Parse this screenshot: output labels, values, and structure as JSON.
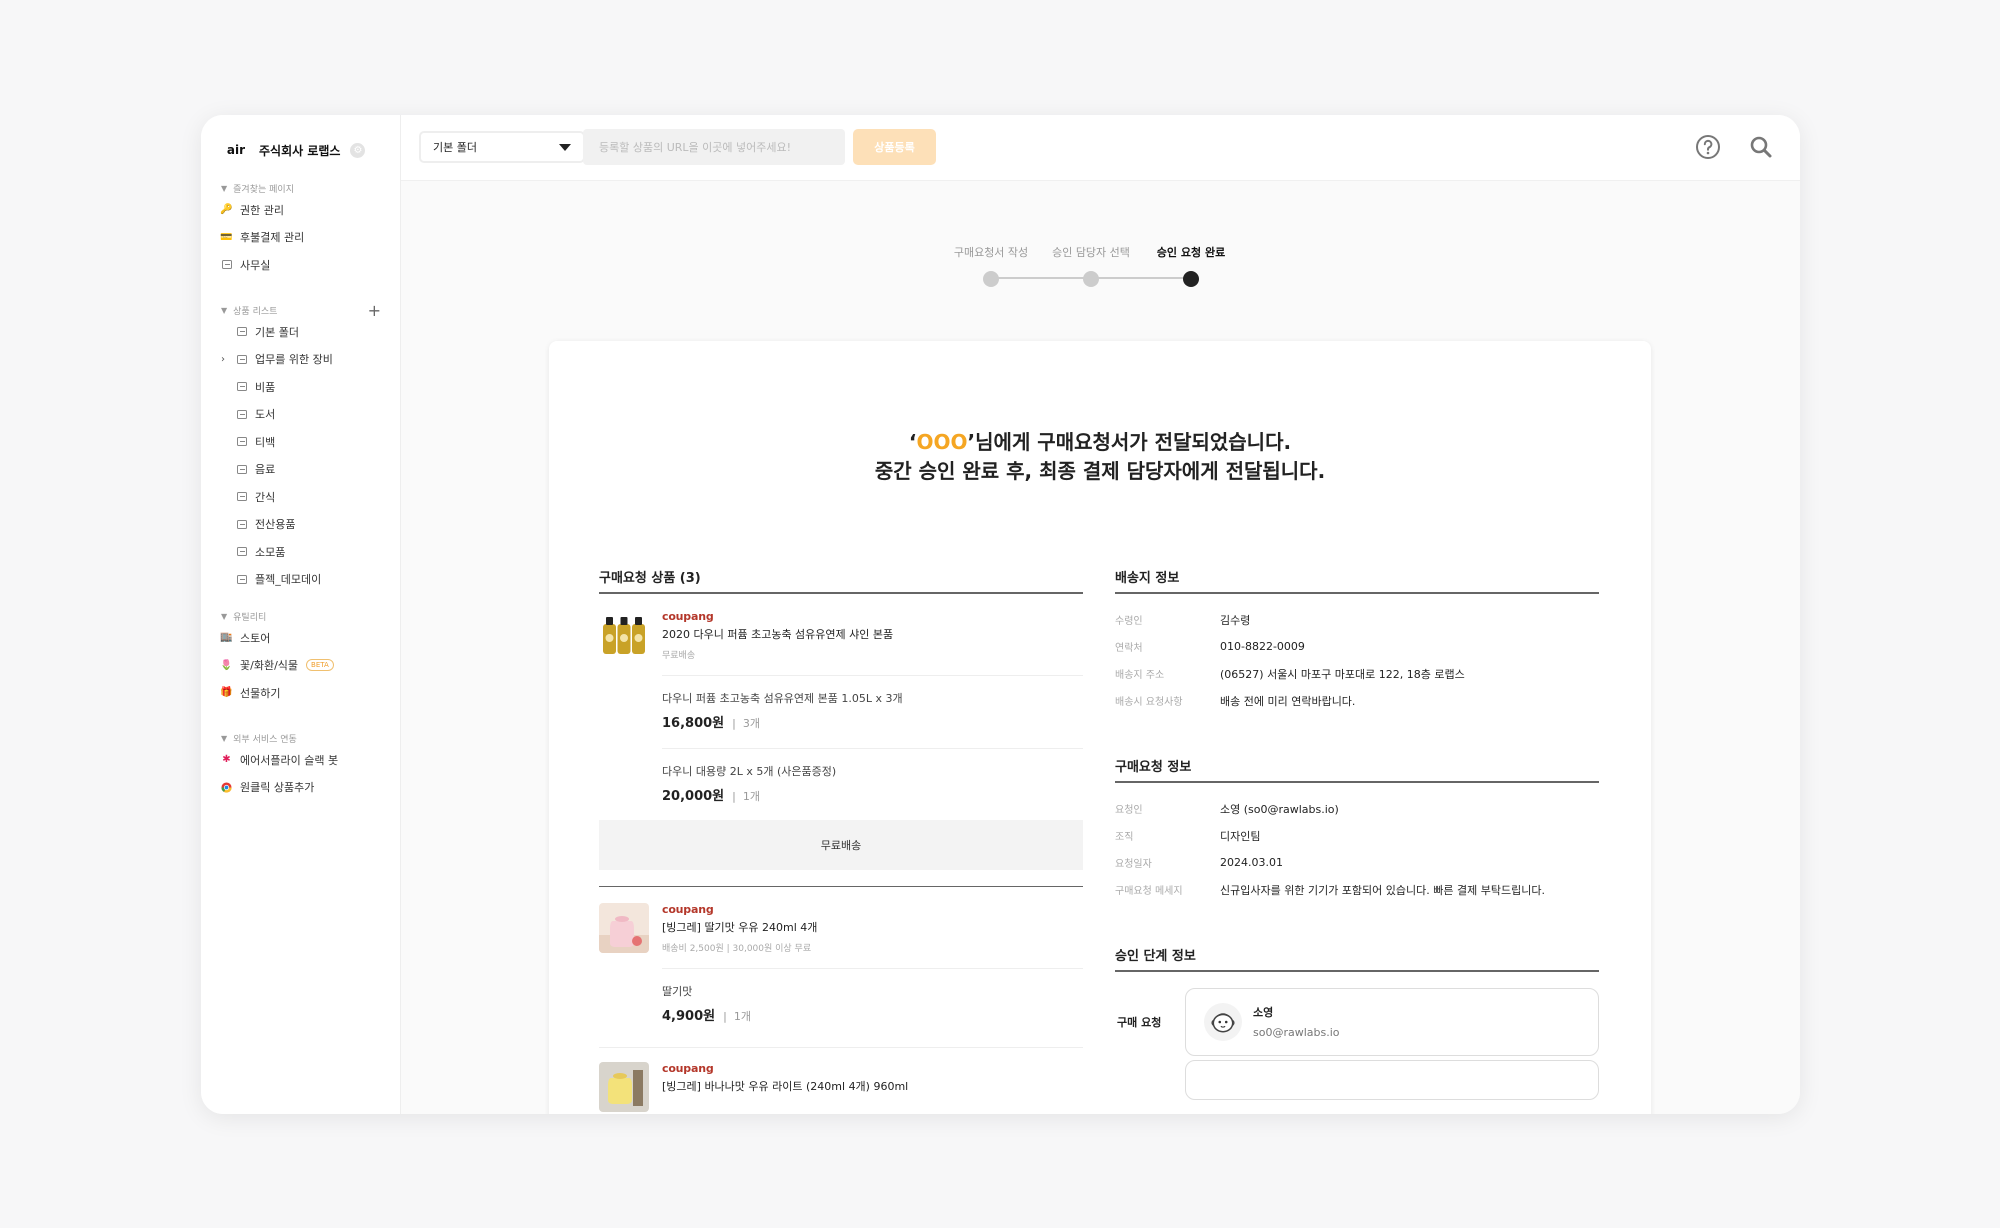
{
  "brand": {
    "logo": "air",
    "company": "주식회사 로랩스"
  },
  "sidebar": {
    "favorites": {
      "title": "즐겨찾는 페이지",
      "items": [
        {
          "label": "권한 관리",
          "icon": "key-icon"
        },
        {
          "label": "후불결제 관리",
          "icon": "card-icon"
        },
        {
          "label": "사무실",
          "icon": "folder-icon"
        }
      ]
    },
    "products": {
      "title": "상품 리스트",
      "items": [
        {
          "label": "기본 폴더"
        },
        {
          "label": "업무를 위한 장비"
        },
        {
          "label": "비품"
        },
        {
          "label": "도서"
        },
        {
          "label": "티백"
        },
        {
          "label": "음료"
        },
        {
          "label": "간식"
        },
        {
          "label": "전산용품"
        },
        {
          "label": "소모품"
        },
        {
          "label": "플젝_데모데이"
        }
      ]
    },
    "utility": {
      "title": "유틸리티",
      "items": [
        {
          "label": "스토어",
          "icon": "store-icon"
        },
        {
          "label": "꽃/화환/식물",
          "icon": "flower-icon",
          "badge": "BETA"
        },
        {
          "label": "선물하기",
          "icon": "gift-icon"
        }
      ]
    },
    "external": {
      "title": "외부 서비스 연동",
      "items": [
        {
          "label": "에어서플라이 슬랙 봇",
          "icon": "slack-icon"
        },
        {
          "label": "원클릭 상품추가",
          "icon": "chrome-icon"
        }
      ]
    }
  },
  "topbar": {
    "folder_select": "기본 폴더",
    "url_placeholder": "등록할 상품의 URL을 이곳에 넣어주세요!",
    "register_button": "상품등록"
  },
  "steps": [
    {
      "label": "구매요청서 작성",
      "active": false
    },
    {
      "label": "승인 담당자 선택",
      "active": false
    },
    {
      "label": "승인 요청 완료",
      "active": true
    }
  ],
  "headline": {
    "line1_open": "‘",
    "line1_highlight": "OOO",
    "line1_rest": "’님에게 구매요청서가 전달되었습니다.",
    "line2": "중간 승인 완료 후, 최종 결제 담당자에게 전달됩니다."
  },
  "order": {
    "title": "구매요청 상품 (3)",
    "products": [
      {
        "brand": "coupang",
        "name": "2020 다우니 퍼퓸 초고농축 섬유유연제 샤인 본품",
        "shipping": "무료배송",
        "options": [
          {
            "name": "다우니 퍼퓸 초고농축 섬유유연제 본품 1.05L x 3개",
            "price": "16,800원",
            "qty": "3개"
          },
          {
            "name": "다우니 대용량 2L x 5개 (사은품증정)",
            "price": "20,000원",
            "qty": "1개"
          }
        ],
        "footer": "무료배송"
      },
      {
        "brand": "coupang",
        "name": "[빙그레] 딸기맛 우유 240ml 4개",
        "shipping": "배송비 2,500원 | 30,000원 이상 무료",
        "options": [
          {
            "name": "딸기맛",
            "price": "4,900원",
            "qty": "1개"
          }
        ]
      },
      {
        "brand": "coupang",
        "name": "[빙그레] 바나나맛 우유 라이트 (240ml 4개) 960ml"
      }
    ]
  },
  "delivery": {
    "title": "배송지 정보",
    "rows": [
      {
        "key": "수령인",
        "value": "김수령"
      },
      {
        "key": "연락처",
        "value": "010-8822-0009"
      },
      {
        "key": "배송지 주소",
        "value": "(06527) 서울시 마포구 마포대로 122, 18층 로랩스"
      },
      {
        "key": "배송시 요청사항",
        "value": "배송 전에 미리 연락바랍니다."
      }
    ]
  },
  "request": {
    "title": "구매요청 정보",
    "rows": [
      {
        "key": "요청인",
        "value": "소영 (so0@rawlabs.io)"
      },
      {
        "key": "조직",
        "value": "디자인팀"
      },
      {
        "key": "요청일자",
        "value": "2024.03.01"
      },
      {
        "key": "구매요청 메세지",
        "value": "신규입사자를 위한 기기가 포함되어 있습니다. 빠른 결제 부탁드립니다."
      }
    ]
  },
  "approval": {
    "title": "승인 단계 정보",
    "step_label": "구매 요청",
    "name": "소영",
    "email": "so0@rawlabs.io"
  },
  "colors": {
    "accent": "#f5a623",
    "register_button": "#fde0b8",
    "notification_dot": "#e53935"
  }
}
